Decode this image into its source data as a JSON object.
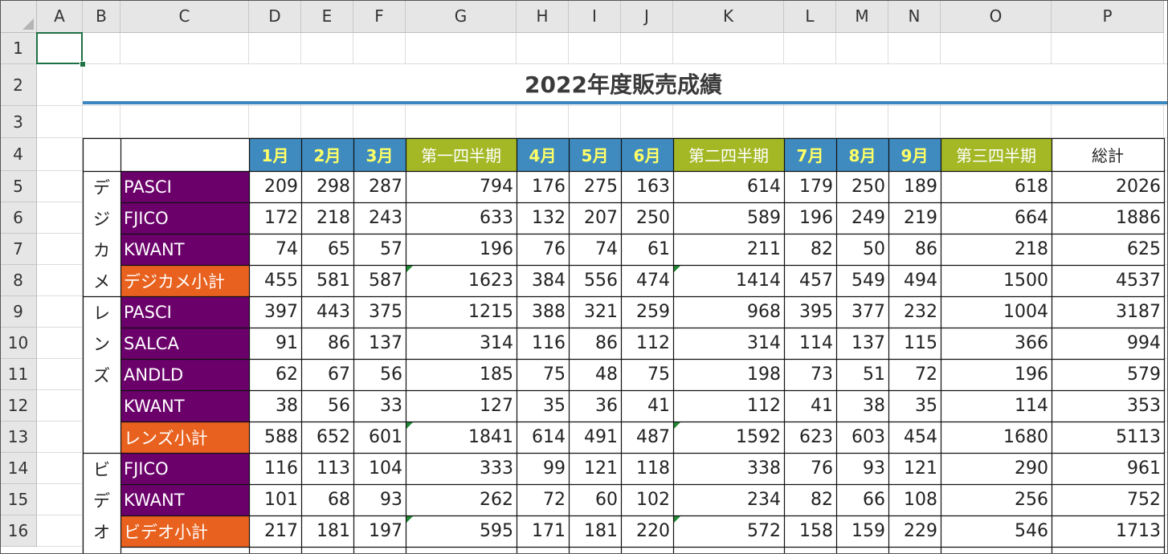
{
  "sheet": {
    "columns": [
      "A",
      "B",
      "C",
      "D",
      "E",
      "F",
      "G",
      "H",
      "I",
      "J",
      "K",
      "L",
      "M",
      "N",
      "O",
      "P"
    ],
    "rows": [
      "1",
      "2",
      "3",
      "4",
      "5",
      "6",
      "7",
      "8",
      "9",
      "10",
      "11",
      "12",
      "13",
      "14",
      "15",
      "16"
    ],
    "title": "2022年度販売成績",
    "accent_line_color": "#3a86c0",
    "selected_cell": "A1"
  },
  "table": {
    "headers": [
      "1月",
      "2月",
      "3月",
      "第一四半期",
      "4月",
      "5月",
      "6月",
      "第二四半期",
      "7月",
      "8月",
      "9月",
      "第三四半期",
      "総計"
    ],
    "header_types": [
      "m",
      "m",
      "m",
      "q",
      "m",
      "m",
      "m",
      "q",
      "m",
      "m",
      "m",
      "q",
      "t"
    ],
    "categories": [
      {
        "chars": [
          "デ",
          "ジ",
          "カ",
          "メ"
        ]
      },
      {
        "chars": [
          "レ",
          "ン",
          "ズ"
        ]
      },
      {
        "chars": [
          "ビ",
          "デ",
          "オ"
        ]
      }
    ],
    "rows": [
      {
        "name": "PASCI",
        "kind": "product",
        "values": [
          209,
          298,
          287,
          794,
          176,
          275,
          163,
          614,
          179,
          250,
          189,
          618,
          2026
        ]
      },
      {
        "name": "FJICO",
        "kind": "product",
        "values": [
          172,
          218,
          243,
          633,
          132,
          207,
          250,
          589,
          196,
          249,
          219,
          664,
          1886
        ]
      },
      {
        "name": "KWANT",
        "kind": "product",
        "values": [
          74,
          65,
          57,
          196,
          76,
          74,
          61,
          211,
          82,
          50,
          86,
          218,
          625
        ]
      },
      {
        "name": "デジカメ小計",
        "kind": "subtotal",
        "values": [
          455,
          581,
          587,
          1623,
          384,
          556,
          474,
          1414,
          457,
          549,
          494,
          1500,
          4537
        ]
      },
      {
        "name": "PASCI",
        "kind": "product",
        "values": [
          397,
          443,
          375,
          1215,
          388,
          321,
          259,
          968,
          395,
          377,
          232,
          1004,
          3187
        ]
      },
      {
        "name": "SALCA",
        "kind": "product",
        "values": [
          91,
          86,
          137,
          314,
          116,
          86,
          112,
          314,
          114,
          137,
          115,
          366,
          994
        ]
      },
      {
        "name": "ANDLD",
        "kind": "product",
        "values": [
          62,
          67,
          56,
          185,
          75,
          48,
          75,
          198,
          73,
          51,
          72,
          196,
          579
        ]
      },
      {
        "name": "KWANT",
        "kind": "product",
        "values": [
          38,
          56,
          33,
          127,
          35,
          36,
          41,
          112,
          41,
          38,
          35,
          114,
          353
        ]
      },
      {
        "name": "レンズ小計",
        "kind": "subtotal",
        "values": [
          588,
          652,
          601,
          1841,
          614,
          491,
          487,
          1592,
          623,
          603,
          454,
          1680,
          5113
        ]
      },
      {
        "name": "FJICO",
        "kind": "product",
        "values": [
          116,
          113,
          104,
          333,
          99,
          121,
          118,
          338,
          76,
          93,
          121,
          290,
          961
        ]
      },
      {
        "name": "KWANT",
        "kind": "product",
        "values": [
          101,
          68,
          93,
          262,
          72,
          60,
          102,
          234,
          82,
          66,
          108,
          256,
          752
        ]
      },
      {
        "name": "ビデオ小計",
        "kind": "subtotal",
        "values": [
          217,
          181,
          197,
          595,
          171,
          181,
          220,
          572,
          158,
          159,
          229,
          546,
          1713
        ]
      }
    ]
  },
  "colors": {
    "month_header_bg": "#3f8bbf",
    "month_header_text": "#ffff66",
    "quarter_header_bg": "#a3b824",
    "product_bg": "#6b006b",
    "subtotal_bg": "#e8611e",
    "error_marker": "#1e8a33"
  }
}
